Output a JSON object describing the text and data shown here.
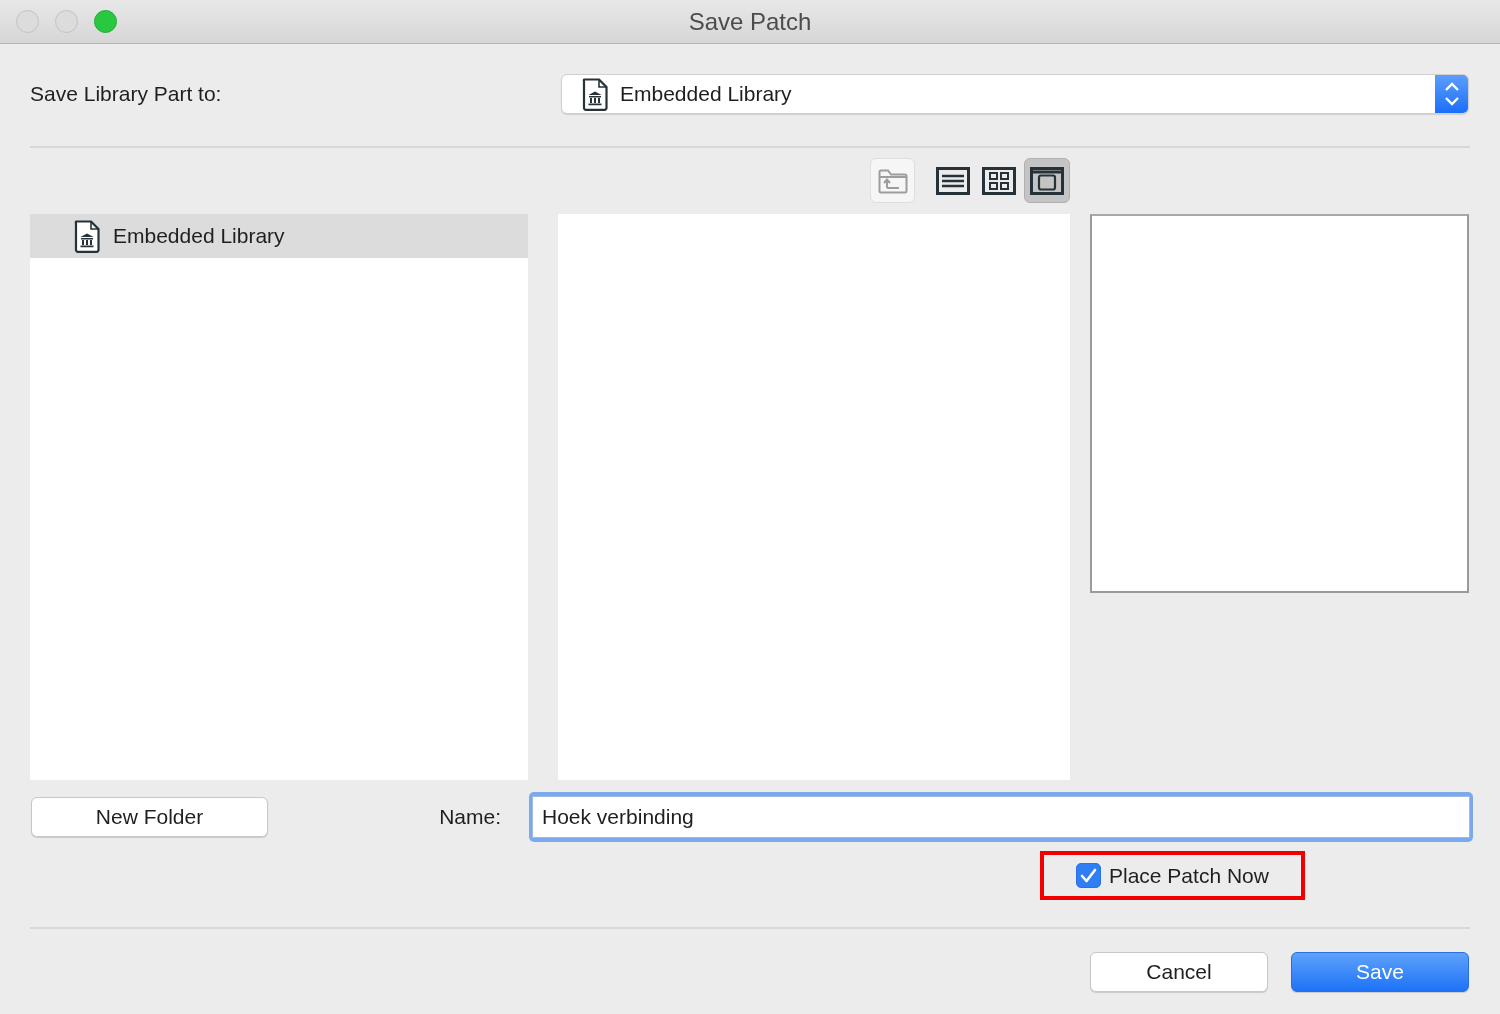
{
  "window": {
    "title": "Save Patch"
  },
  "save_to": {
    "label": "Save Library Part to:",
    "value": "Embedded Library"
  },
  "toolbar": {
    "up_button": {
      "disabled": true
    },
    "views": [
      {
        "kind": "list",
        "selected": false
      },
      {
        "kind": "grid",
        "selected": false
      },
      {
        "kind": "preview",
        "selected": true
      }
    ]
  },
  "sidebar": {
    "items": [
      {
        "label": "Embedded Library",
        "selected": true
      }
    ]
  },
  "new_folder_button": "New Folder",
  "name_field": {
    "label": "Name:",
    "value": "Hoek verbinding",
    "focused": true
  },
  "place_patch_now": {
    "label": "Place Patch Now",
    "checked": true,
    "highlighted": true
  },
  "buttons": [
    {
      "label": "Cancel",
      "kind": "default"
    },
    {
      "label": "Save",
      "kind": "primary"
    }
  ]
}
